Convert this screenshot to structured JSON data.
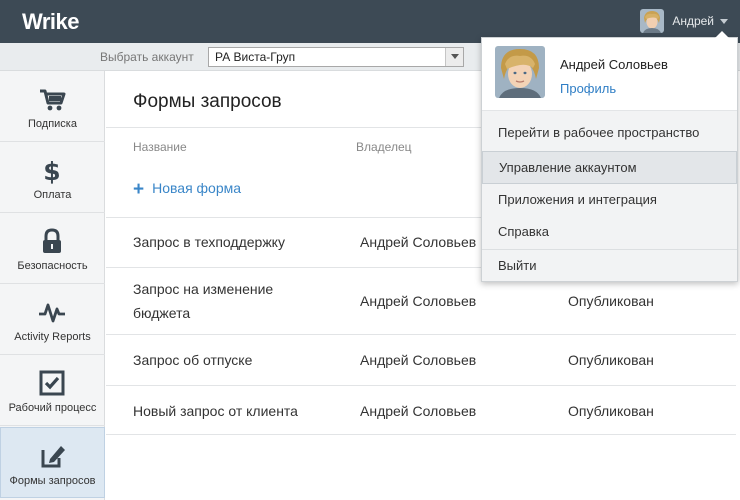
{
  "topbar": {
    "logo": "Wrike",
    "user_name": "Андрей",
    "avatar_icon": "user-avatar-icon"
  },
  "account_bar": {
    "label": "Выбрать аккаунт",
    "selected": "РА Виста-Груп"
  },
  "sidebar": {
    "items": [
      {
        "label": "Подписка",
        "icon": "cart-icon"
      },
      {
        "label": "Оплата",
        "icon": "dollar-icon"
      },
      {
        "label": "Безопасность",
        "icon": "lock-icon"
      },
      {
        "label": "Activity Reports",
        "icon": "pulse-icon"
      },
      {
        "label": "Рабочий процесс",
        "icon": "checkbox-icon"
      },
      {
        "label": "Формы запросов",
        "icon": "edit-icon"
      }
    ],
    "active_index": 5
  },
  "main": {
    "title": "Формы запросов",
    "columns": {
      "name": "Название",
      "owner": "Владелец"
    },
    "new_form": "Новая форма",
    "rows": [
      {
        "name": "Запрос в техподдержку",
        "owner": "Андрей Соловьев",
        "status": ""
      },
      {
        "name_line1": "Запрос на изменение",
        "name_line2": "бюджета",
        "owner": "Андрей Соловьев",
        "status": "Опубликован"
      },
      {
        "name": "Запрос об отпуске",
        "owner": "Андрей Соловьев",
        "status": "Опубликован"
      },
      {
        "name": "Новый запрос от клиента",
        "owner": "Андрей Соловьев",
        "status": "Опубликован"
      }
    ]
  },
  "dropdown": {
    "full_name": "Андрей Соловьев",
    "profile_link": "Профиль",
    "items": [
      "Перейти в рабочее пространство",
      "Управление аккаунтом",
      "Приложения и интеграция",
      "Справка",
      "Выйти"
    ],
    "highlighted_index": 1
  },
  "colors": {
    "topbar": "#3d4a55",
    "accent": "#3a86c8",
    "logo_tick": "#8cc63f"
  }
}
